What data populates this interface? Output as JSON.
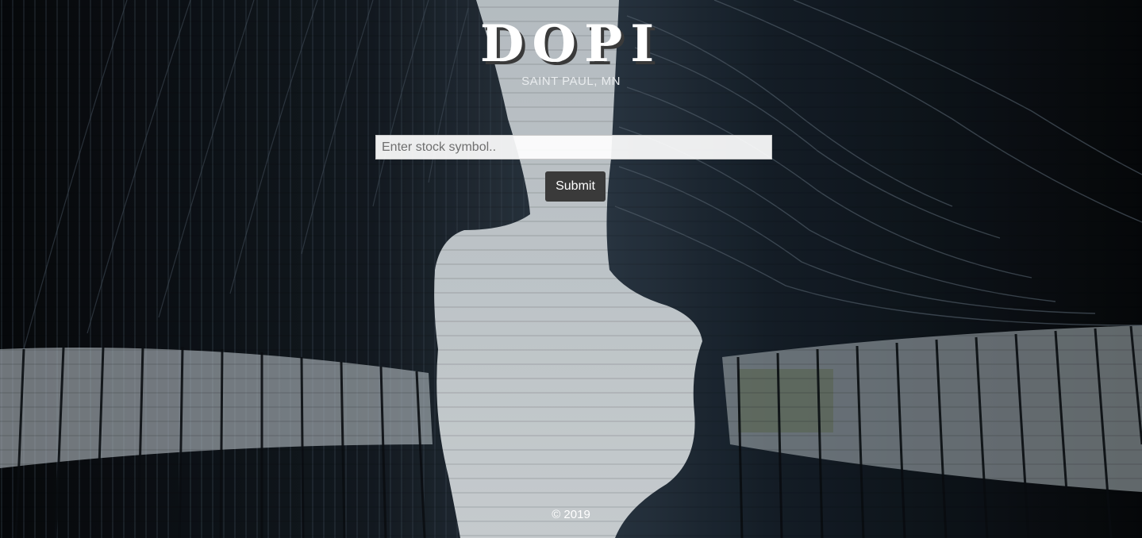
{
  "brand": {
    "title": "DOPI",
    "location": "SAINT PAUL, MN"
  },
  "search": {
    "placeholder": "Enter stock symbol..",
    "value": ""
  },
  "actions": {
    "submit_label": "Submit"
  },
  "footer": {
    "copyright": "© 2019"
  },
  "colors": {
    "button_bg": "#3a3a3a",
    "sky": "#cfd6da",
    "building_dark": "#0d1115"
  }
}
